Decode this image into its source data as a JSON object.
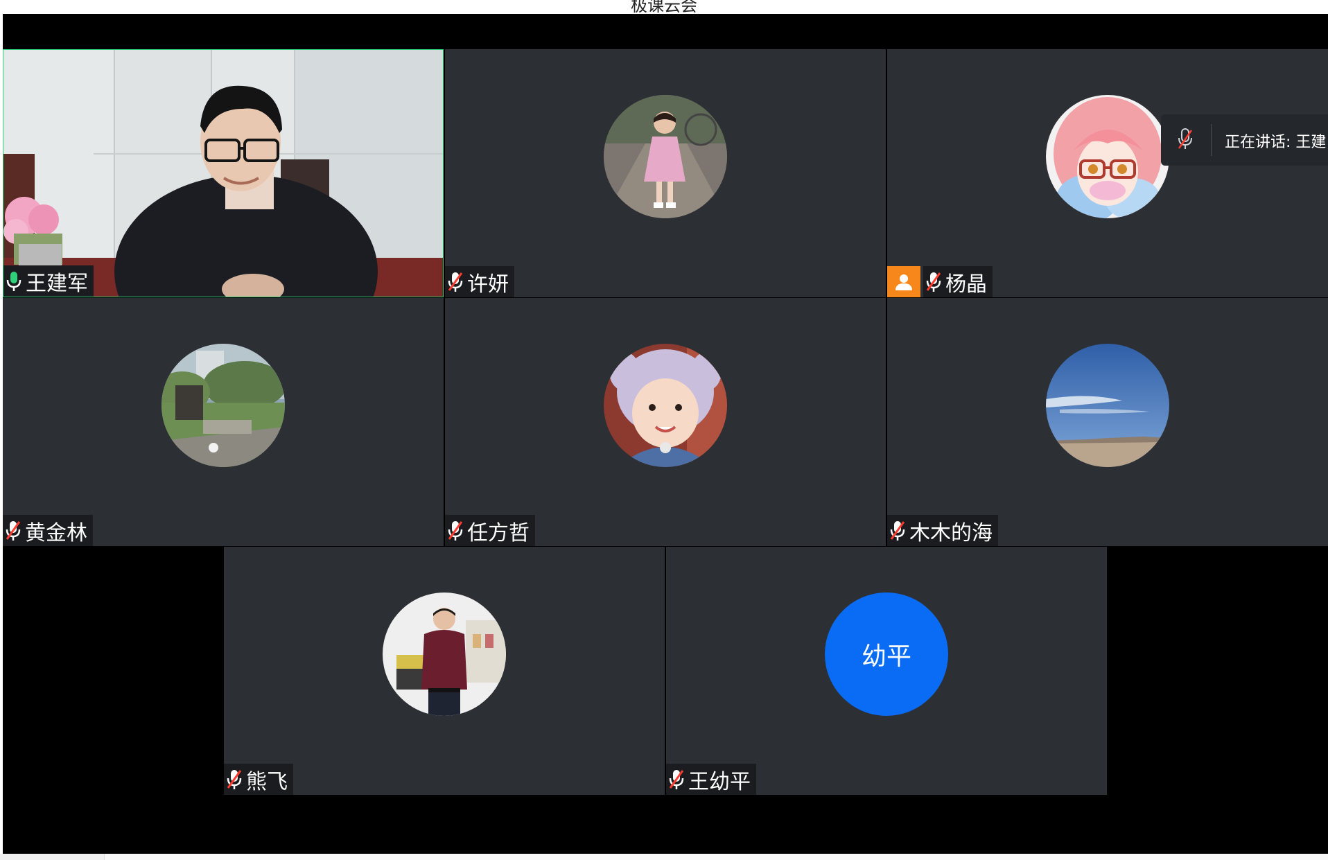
{
  "window": {
    "title": "极课云会"
  },
  "speaking_banner": {
    "text": "正在讲话: 王建"
  },
  "avatar_text": {
    "wang_youping": "幼平"
  },
  "participants": [
    {
      "name": "王建军",
      "mic": "on",
      "video": true,
      "active_speaker": true
    },
    {
      "name": "许妍",
      "mic": "muted"
    },
    {
      "name": "杨晶",
      "mic": "muted",
      "role": "host"
    },
    {
      "name": "黄金林",
      "mic": "muted"
    },
    {
      "name": "任方哲",
      "mic": "muted"
    },
    {
      "name": "木木的海",
      "mic": "muted"
    },
    {
      "name": "熊飞",
      "mic": "muted"
    },
    {
      "name": "王幼平",
      "mic": "muted"
    }
  ],
  "colors": {
    "tile_bg": "#2c2f33",
    "stage_bg": "#000000",
    "speaker_border": "#2fd07a",
    "mic_on": "#2fd07a",
    "mic_muted": "#ff3b30",
    "host_badge": "#f7871a",
    "text_avatar": "#0a6cf5"
  },
  "icons": {
    "mic_on": "microphone-icon",
    "mic_muted": "microphone-muted-icon",
    "host": "user-icon"
  }
}
